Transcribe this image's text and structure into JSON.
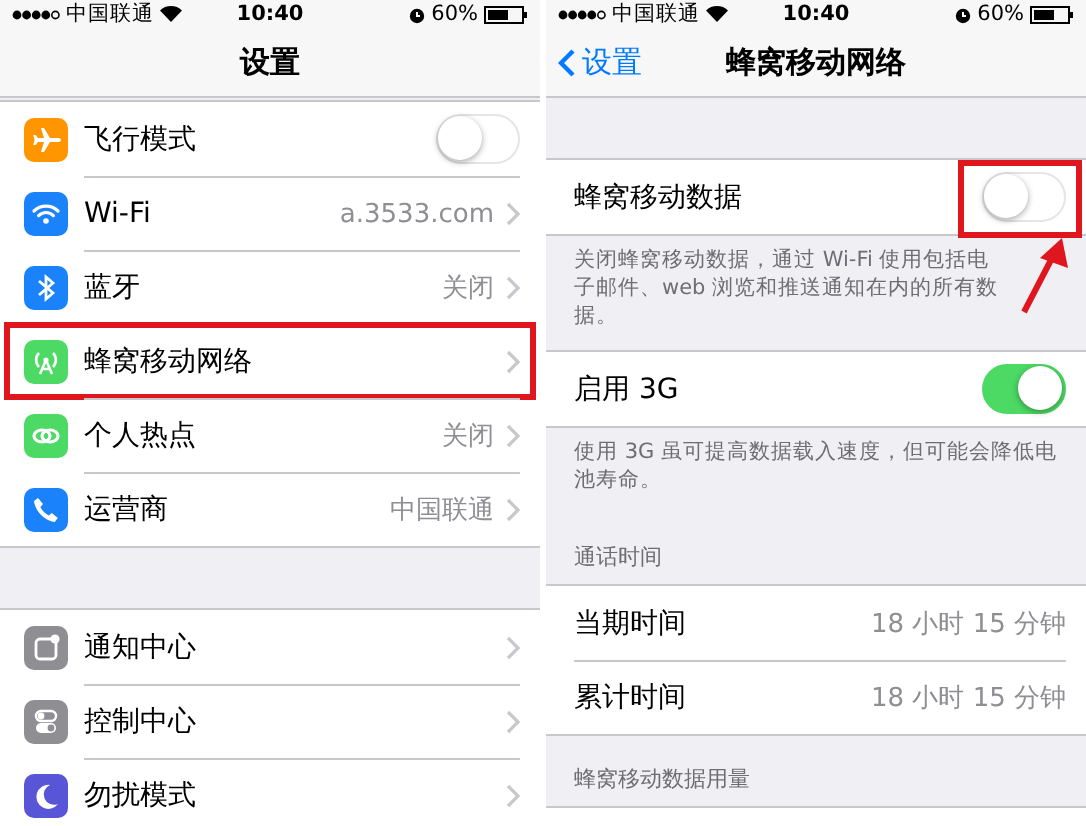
{
  "screens": [
    {
      "status_bar": {
        "carrier": "中国联通",
        "time": "10:40",
        "battery": "60%"
      },
      "nav": {
        "title": "设置"
      },
      "groups": [
        {
          "rows": [
            {
              "kind": "toggle",
              "label": "飞行模式",
              "on": false,
              "color": "#ff9500",
              "annotated": false
            },
            {
              "kind": "link",
              "label": "Wi-Fi",
              "value": "a.3533.com",
              "color": "#1a82fb",
              "annotated": false
            },
            {
              "kind": "link",
              "label": "蓝牙",
              "value": "关闭",
              "color": "#1a82fb",
              "annotated": false
            },
            {
              "kind": "link",
              "label": "蜂窝移动网络",
              "color": "#4cd964",
              "annotated": true
            },
            {
              "kind": "link",
              "label": "个人热点",
              "value": "关闭",
              "color": "#4cd964",
              "annotated": false
            },
            {
              "kind": "link",
              "label": "运营商",
              "value": "中国联通",
              "color": "#1a82fb",
              "annotated": false
            }
          ]
        },
        {
          "rows": [
            {
              "kind": "link",
              "label": "通知中心",
              "color": "#8e8e93",
              "annotated": false
            },
            {
              "kind": "link",
              "label": "控制中心",
              "color": "#8e8e93",
              "annotated": false
            },
            {
              "kind": "link",
              "label": "勿扰模式",
              "color": "#5856d6",
              "annotated": false
            }
          ]
        }
      ]
    },
    {
      "status_bar": {
        "carrier": "中国联通",
        "time": "10:40",
        "battery": "60%"
      },
      "nav": {
        "back": "设置",
        "title": "蜂窝移动网络"
      },
      "groups": [
        {
          "rows": [
            {
              "kind": "toggle",
              "label": "蜂窝移动数据",
              "on": false,
              "annotated": true
            }
          ],
          "footer": "关闭蜂窝移动数据，通过 Wi-Fi 使用包括电子邮件、web 浏览和推送通知在内的所有数据。"
        },
        {
          "rows": [
            {
              "kind": "toggle",
              "label": "启用 3G",
              "on": true,
              "annotated": false
            }
          ],
          "footer": "使用 3G 虽可提高数据载入速度，但可能会降低电池寿命。"
        },
        {
          "header": "通话时间",
          "rows": [
            {
              "kind": "link",
              "label": "当期时间",
              "value": "18 小时 15 分钟",
              "chevron": false,
              "annotated": false
            },
            {
              "kind": "link",
              "label": "累计时间",
              "value": "18 小时 15 分钟",
              "chevron": false,
              "annotated": false
            }
          ]
        },
        {
          "header": "蜂窝移动数据用量"
        }
      ]
    }
  ]
}
